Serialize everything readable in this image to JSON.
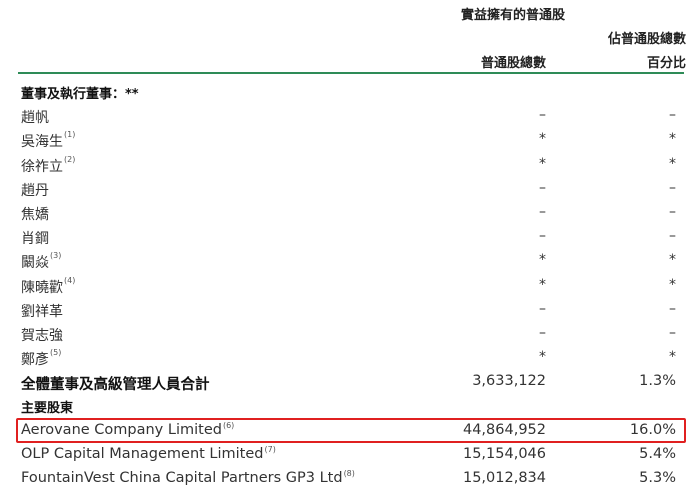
{
  "header": {
    "group_title": "實益擁有的普通股",
    "pct_line1": "佔普通股總數",
    "shares_label": "普通股總數",
    "pct_line2": "百分比"
  },
  "rows": [
    {
      "label": "董事及執行董事：**",
      "note": "",
      "shares": "",
      "pct": "",
      "bold": true
    },
    {
      "label": "趙帆",
      "note": "",
      "shares": "–",
      "pct": "–"
    },
    {
      "label": "吳海生",
      "note": "(1)",
      "shares": "*",
      "pct": "*"
    },
    {
      "label": "徐祚立",
      "note": "(2)",
      "shares": "*",
      "pct": "*"
    },
    {
      "label": "趙丹",
      "note": "",
      "shares": "–",
      "pct": "–"
    },
    {
      "label": "焦嬌",
      "note": "",
      "shares": "–",
      "pct": "–"
    },
    {
      "label": "肖鋼",
      "note": "",
      "shares": "–",
      "pct": "–"
    },
    {
      "label": "闞焱",
      "note": "(3)",
      "shares": "*",
      "pct": "*"
    },
    {
      "label": "陳曉歡",
      "note": "(4)",
      "shares": "*",
      "pct": "*"
    },
    {
      "label": "劉祥革",
      "note": "",
      "shares": "–",
      "pct": "–"
    },
    {
      "label": "賀志強",
      "note": "",
      "shares": "–",
      "pct": "–"
    },
    {
      "label": "鄭彥",
      "note": "(5)",
      "shares": "*",
      "pct": "*"
    },
    {
      "label": "全體董事及高級管理人員合計",
      "note": "",
      "shares": "3,633,122",
      "pct": "1.3%",
      "bold": true
    },
    {
      "label": "主要股東",
      "note": "",
      "shares": "",
      "pct": "",
      "bold": true
    },
    {
      "label": "Aerovane Company Limited",
      "note": "(6)",
      "shares": "44,864,952",
      "pct": "16.0%"
    },
    {
      "label": "OLP Capital Management Limited",
      "note": "(7)",
      "shares": "15,154,046",
      "pct": "5.4%"
    },
    {
      "label": "FountainVest China Capital Partners GP3 Ltd",
      "note": "(8)",
      "shares": "15,012,834",
      "pct": "5.3%"
    }
  ]
}
